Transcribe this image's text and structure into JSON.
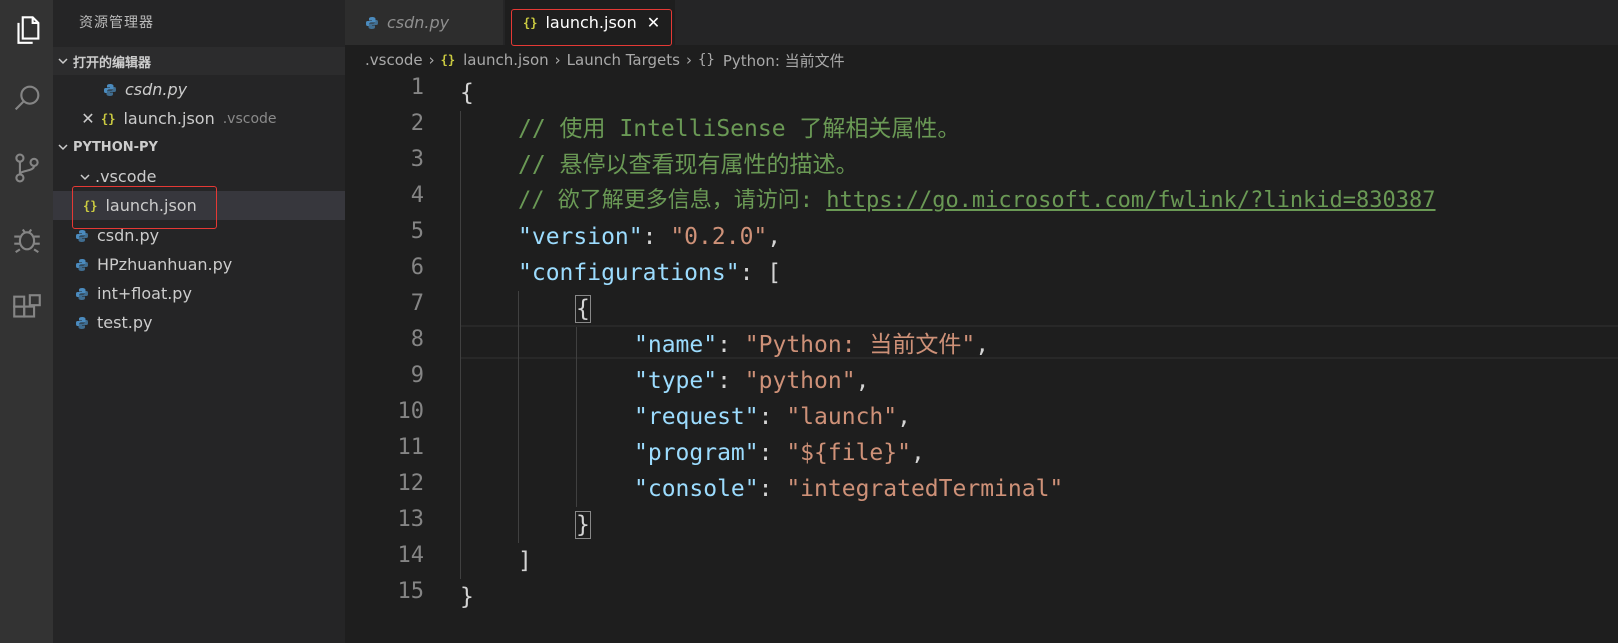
{
  "sidebar": {
    "title": "资源管理器",
    "open_editors": {
      "label": "打开的编辑器",
      "items": [
        {
          "name": "csdn.py"
        },
        {
          "name": "launch.json",
          "folder": ".vscode"
        }
      ]
    },
    "workspace": {
      "label": "PYTHON-PY",
      "folder": ".vscode",
      "folder_child": "launch.json",
      "files": [
        "csdn.py",
        "HPzhuanhuan.py",
        "int+float.py",
        "test.py"
      ]
    }
  },
  "tabs": [
    {
      "label": "csdn.py",
      "active": false
    },
    {
      "label": "launch.json",
      "active": true
    }
  ],
  "breadcrumb": [
    ".vscode",
    "launch.json",
    "Launch Targets",
    "Python: 当前文件"
  ],
  "editor": {
    "line_numbers": [
      "1",
      "2",
      "3",
      "4",
      "5",
      "6",
      "7",
      "8",
      "9",
      "10",
      "11",
      "12",
      "13",
      "14",
      "15"
    ],
    "code": {
      "l1": "{",
      "l2": "// 使用 IntelliSense 了解相关属性。",
      "l3": "// 悬停以查看现有属性的描述。",
      "l4_comment": "// 欲了解更多信息，请访问: ",
      "l4_url": "https://go.microsoft.com/fwlink/?linkid=830387",
      "version_key": "\"version\"",
      "version_val": "\"0.2.0\"",
      "configurations_key": "\"configurations\"",
      "open_bracket": "[",
      "open_brace": "{",
      "name_key": "\"name\"",
      "name_val": "\"Python: 当前文件\"",
      "type_key": "\"type\"",
      "type_val": "\"python\"",
      "request_key": "\"request\"",
      "request_val": "\"launch\"",
      "program_key": "\"program\"",
      "program_val": "\"${file}\"",
      "console_key": "\"console\"",
      "console_val": "\"integratedTerminal\"",
      "close_brace": "}",
      "close_bracket": "]",
      "l15": "}"
    }
  },
  "colors": {
    "comment": "#6a9955",
    "key": "#9cdcfe",
    "string": "#ce9178",
    "json_icon": "#cbcb41",
    "python_icon": "#4b8bbe",
    "annotation": "#e53935"
  },
  "icons": {
    "activity": [
      "files-icon",
      "search-icon",
      "source-control-icon",
      "debug-icon",
      "extensions-icon"
    ],
    "file_python": "python-file-icon",
    "file_json": "json-file-icon",
    "tab_close": "close-icon"
  }
}
